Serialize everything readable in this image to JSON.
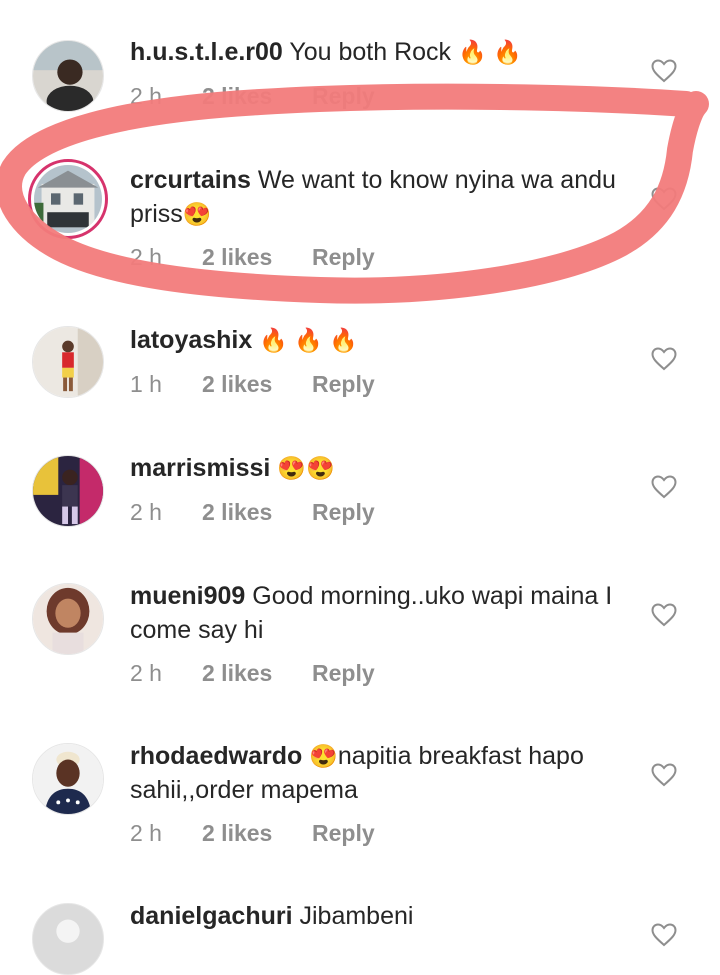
{
  "comments": [
    {
      "username": "h.u.s.t.l.e.r00",
      "text": "You both Rock",
      "emoji": "🔥 🔥",
      "time": "2 h",
      "likes": "2 likes",
      "reply": "Reply"
    },
    {
      "username": "crcurtains",
      "text": "We want to know nyina wa andu priss",
      "emoji": "😍",
      "time": "2 h",
      "likes": "2 likes",
      "reply": "Reply"
    },
    {
      "username": "latoyashix",
      "text": "",
      "emoji": "🔥 🔥 🔥",
      "time": "1 h",
      "likes": "2 likes",
      "reply": "Reply"
    },
    {
      "username": "marrismissi",
      "text": "",
      "emoji": "😍😍",
      "time": "2 h",
      "likes": "2 likes",
      "reply": "Reply"
    },
    {
      "username": "mueni909",
      "text": "Good morning..uko wapi maina I come say hi",
      "emoji": "",
      "time": "2 h",
      "likes": "2 likes",
      "reply": "Reply"
    },
    {
      "username": "rhodaedwardo",
      "text": "napitia breakfast hapo sahii,,order mapema",
      "emoji": "😍",
      "time": "2 h",
      "likes": "2 likes",
      "reply": "Reply"
    },
    {
      "username": "danielgachuri",
      "text": "Jibambeni",
      "emoji": "",
      "time": "",
      "likes": "",
      "reply": ""
    }
  ],
  "colors": {
    "highlight_circle": "#f27b7b",
    "meta_text": "#8e8e8e",
    "primary_text": "#262626"
  }
}
